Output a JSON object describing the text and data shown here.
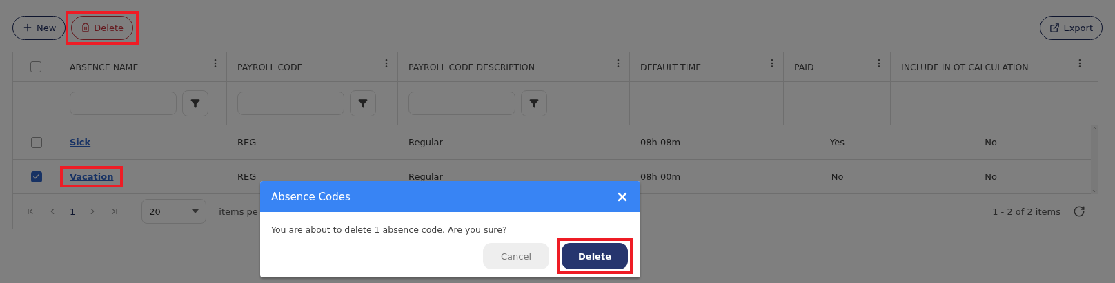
{
  "toolbar": {
    "buttons": [
      {
        "label": "New",
        "kind": "new",
        "highlighted": false
      },
      {
        "label": "Delete",
        "kind": "delete",
        "highlighted": true
      }
    ],
    "export": {
      "label": "Export"
    }
  },
  "table": {
    "select_all": {
      "checked": false
    },
    "columns": [
      {
        "label": "ABSENCE NAME",
        "kind": "link",
        "filter": true
      },
      {
        "label": "PAYROLL CODE",
        "kind": "text",
        "filter": true
      },
      {
        "label": "PAYROLL CODE DESCRIPTION",
        "kind": "text",
        "filter": true
      },
      {
        "label": "DEFAULT TIME",
        "kind": "text",
        "filter": false
      },
      {
        "label": "PAID",
        "kind": "flag",
        "filter": false
      },
      {
        "label": "INCLUDE IN OT CALCULATION",
        "kind": "flag",
        "filter": false
      }
    ],
    "rows": [
      {
        "checked": false,
        "highlighted": false,
        "cells": [
          "Sick",
          "REG",
          "Regular",
          "08h 08m",
          "Yes",
          "No"
        ]
      },
      {
        "checked": true,
        "highlighted": true,
        "cells": [
          "Vacation",
          "REG",
          "Regular",
          "08h 00m",
          "No",
          "No"
        ]
      }
    ]
  },
  "pager": {
    "page": "1",
    "page_size": "20",
    "page_size_label": "items pe",
    "summary": "1 - 2 of 2 items"
  },
  "dialog": {
    "title": "Absence Codes",
    "message": "You are about to delete 1 absence code. Are you sure?",
    "buttons": [
      {
        "label": "Cancel",
        "kind": "secondary",
        "highlighted": false
      },
      {
        "label": "Delete",
        "kind": "primary",
        "highlighted": true
      }
    ]
  }
}
